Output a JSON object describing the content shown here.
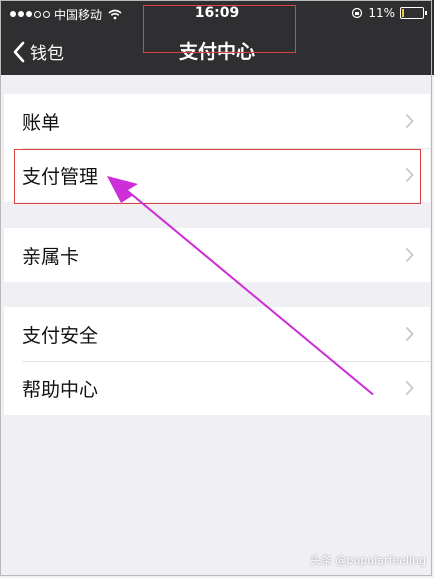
{
  "status_bar": {
    "carrier": "中国移动",
    "time": "16:09",
    "battery": "11%",
    "battery_level": 0.11
  },
  "nav": {
    "back_label": "钱包",
    "title": "支付中心"
  },
  "menu_groups": [
    {
      "items": [
        {
          "label": "账单"
        },
        {
          "label": "支付管理"
        }
      ]
    },
    {
      "items": [
        {
          "label": "亲属卡"
        }
      ]
    },
    {
      "items": [
        {
          "label": "支付安全"
        },
        {
          "label": "帮助中心"
        }
      ]
    }
  ],
  "watermark": "头条 @popularfeeling",
  "colors": {
    "nav_bg": "#2f2f31",
    "page_bg": "#efeff4",
    "annotation_red": "#d94545",
    "arrow_magenta": "#cc2fd8"
  },
  "icons": {
    "back": "chevron-left-icon",
    "row": "chevron-right-icon",
    "wifi": "wifi-icon",
    "battery": "battery-icon"
  }
}
